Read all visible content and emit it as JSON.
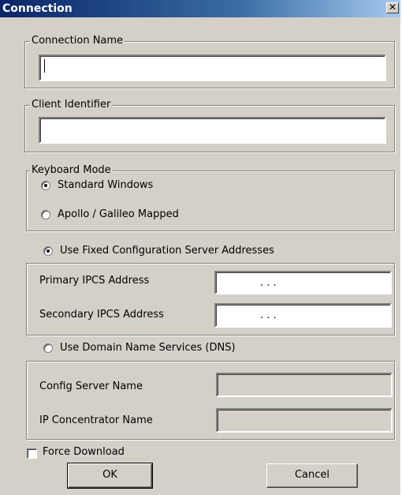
{
  "window": {
    "title": "Connection",
    "close_glyph": "✕"
  },
  "connection_name": {
    "legend": "Connection Name",
    "value": ""
  },
  "client_identifier": {
    "legend": "Client Identifier",
    "value": ""
  },
  "keyboard_mode": {
    "legend": "Keyboard Mode",
    "options": [
      {
        "label": "Standard Windows",
        "selected": true
      },
      {
        "label": "Apollo / Galileo Mapped",
        "selected": false
      }
    ]
  },
  "fixed_config": {
    "label": "Use Fixed Configuration Server Addresses",
    "selected": true,
    "primary_label": "Primary IPCS Address",
    "secondary_label": "Secondary IPCS Address",
    "ip_dots": ".           .           ."
  },
  "dns": {
    "label": "Use Domain Name Services (DNS)",
    "selected": false,
    "config_server_label": "Config Server Name",
    "ip_concentrator_label": "IP Concentrator  Name"
  },
  "force_download": {
    "label": "Force Download",
    "checked": false
  },
  "buttons": {
    "ok": "OK",
    "cancel": "Cancel"
  }
}
